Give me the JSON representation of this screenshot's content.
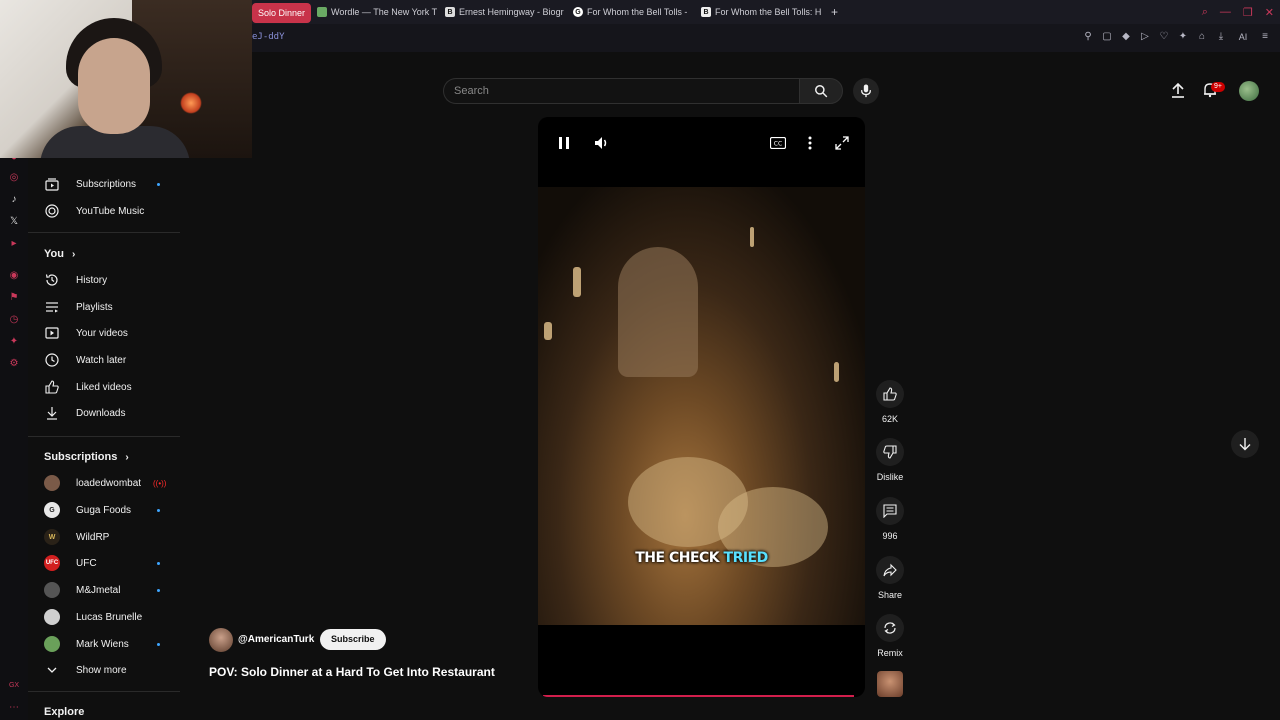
{
  "browser": {
    "tabs": [
      {
        "label": "Solo Dinner",
        "active": true,
        "favicon": "youtube-icon"
      },
      {
        "label": "Wordle — The New York T",
        "active": false,
        "favicon": "wordle-icon"
      },
      {
        "label": "Ernest Hemingway - Biogr",
        "active": false,
        "favicon": "bio-icon"
      },
      {
        "label": "For Whom the Bell Tolls -",
        "active": false,
        "favicon": "google-icon"
      },
      {
        "label": "For Whom the Bell Tolls: H",
        "active": false,
        "favicon": "bookmark-icon"
      }
    ],
    "new_tab": "+",
    "url_fragment": "eJ-ddY",
    "accent": "#c8334a"
  },
  "header": {
    "search_placeholder": "Search",
    "notification_badge": "9+"
  },
  "sidebar": {
    "top_items": [
      {
        "label": "Subscriptions",
        "icon": "subscriptions-icon",
        "dot": true
      },
      {
        "label": "YouTube Music",
        "icon": "music-icon",
        "dot": false
      }
    ],
    "you_heading": "You",
    "you_items": [
      {
        "label": "History",
        "icon": "history-icon"
      },
      {
        "label": "Playlists",
        "icon": "playlists-icon"
      },
      {
        "label": "Your videos",
        "icon": "your-videos-icon"
      },
      {
        "label": "Watch later",
        "icon": "clock-icon"
      },
      {
        "label": "Liked videos",
        "icon": "thumbs-up-icon"
      },
      {
        "label": "Downloads",
        "icon": "download-icon"
      }
    ],
    "subs_heading": "Subscriptions",
    "subscriptions": [
      {
        "label": "loadedwombat",
        "status": "live",
        "color": "#7a5a48"
      },
      {
        "label": "Guga Foods",
        "status": "dot",
        "color": "#e8e8e8"
      },
      {
        "label": "WildRP",
        "status": "none",
        "color": "#d8b65a"
      },
      {
        "label": "UFC",
        "status": "dot",
        "color": "#d21f1f"
      },
      {
        "label": "M&Jmetal",
        "status": "dot",
        "color": "#555555"
      },
      {
        "label": "Lucas Brunelle",
        "status": "none",
        "color": "#cfcfcf"
      },
      {
        "label": "Mark Wiens",
        "status": "dot",
        "color": "#6aa05a"
      }
    ],
    "show_more": "Show more",
    "explore_heading": "Explore"
  },
  "player": {
    "caption_main": "THE CHECK",
    "caption_highlight": "TRIED",
    "progress_fraction": 0.98
  },
  "actions": {
    "likes": "62K",
    "dislike": "Dislike",
    "comments": "996",
    "share": "Share",
    "remix": "Remix"
  },
  "meta": {
    "channel": "@AmericanTurk",
    "subscribe": "Subscribe",
    "title": "POV: Solo Dinner at a Hard To Get Into Restaurant"
  }
}
